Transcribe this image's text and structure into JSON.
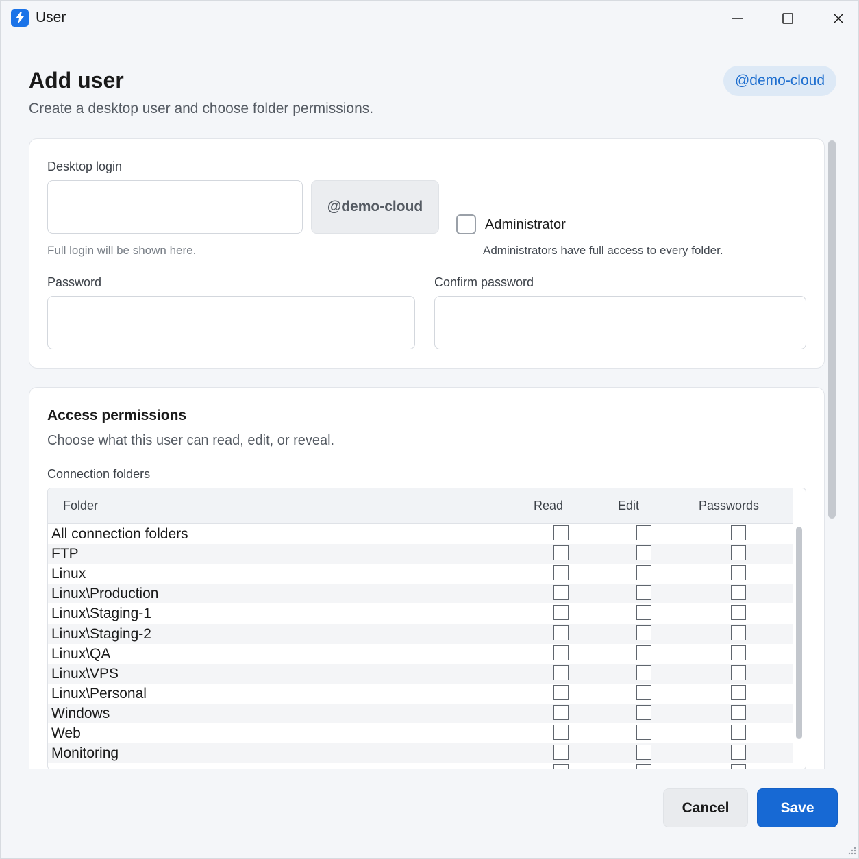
{
  "window": {
    "title": "User",
    "app_icon": "lightning-bolt-icon",
    "controls": [
      "minimize-icon",
      "maximize-icon",
      "close-icon"
    ]
  },
  "header": {
    "title": "Add user",
    "subtitle": "Create a desktop user and choose folder permissions.",
    "tenant_badge": "@demo-cloud"
  },
  "login": {
    "label": "Desktop login",
    "value": "",
    "suffix": "@demo-cloud",
    "hint": "Full login will be shown here.",
    "administrator": {
      "label": "Administrator",
      "checked": false,
      "hint": "Administrators have full access to every folder."
    },
    "password_label": "Password",
    "password_value": "",
    "confirm_label": "Confirm password",
    "confirm_value": ""
  },
  "permissions": {
    "title": "Access permissions",
    "subtitle": "Choose what this user can read, edit, or reveal.",
    "table_label": "Connection folders",
    "columns": [
      "Folder",
      "Read",
      "Edit",
      "Passwords"
    ],
    "rows": [
      {
        "folder": "All connection folders",
        "read": false,
        "edit": false,
        "passwords": false
      },
      {
        "folder": "FTP",
        "read": false,
        "edit": false,
        "passwords": false
      },
      {
        "folder": "Linux",
        "read": false,
        "edit": false,
        "passwords": false
      },
      {
        "folder": "Linux\\Production",
        "read": false,
        "edit": false,
        "passwords": false
      },
      {
        "folder": "Linux\\Staging-1",
        "read": false,
        "edit": false,
        "passwords": false
      },
      {
        "folder": "Linux\\Staging-2",
        "read": false,
        "edit": false,
        "passwords": false
      },
      {
        "folder": "Linux\\QA",
        "read": false,
        "edit": false,
        "passwords": false
      },
      {
        "folder": "Linux\\VPS",
        "read": false,
        "edit": false,
        "passwords": false
      },
      {
        "folder": "Linux\\Personal",
        "read": false,
        "edit": false,
        "passwords": false
      },
      {
        "folder": "Windows",
        "read": false,
        "edit": false,
        "passwords": false
      },
      {
        "folder": "Web",
        "read": false,
        "edit": false,
        "passwords": false
      },
      {
        "folder": "Monitoring",
        "read": false,
        "edit": false,
        "passwords": false
      },
      {
        "folder": "",
        "read": false,
        "edit": false,
        "passwords": false
      }
    ]
  },
  "footer": {
    "cancel_label": "Cancel",
    "save_label": "Save"
  },
  "colors": {
    "accent": "#1769d4",
    "badge_bg": "#dde9f6",
    "badge_text": "#1f6fcf"
  }
}
